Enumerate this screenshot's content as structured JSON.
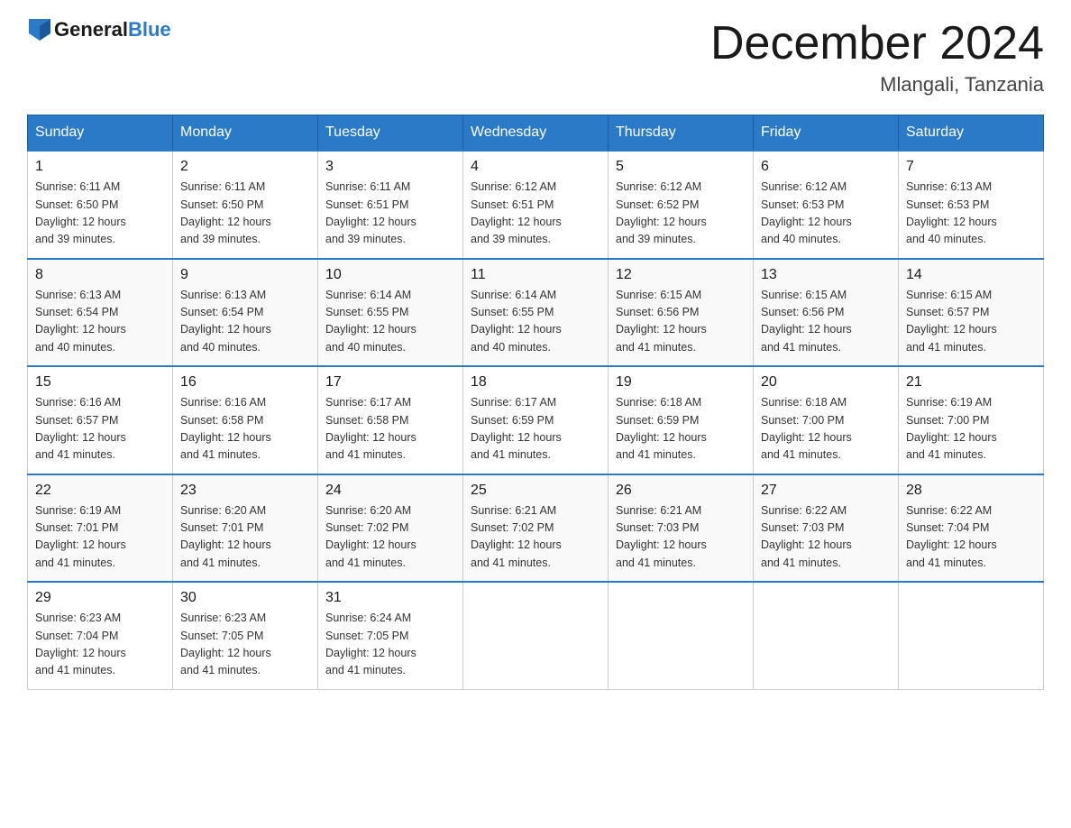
{
  "logo": {
    "general": "General",
    "blue": "Blue"
  },
  "title": "December 2024",
  "location": "Mlangali, Tanzania",
  "days_of_week": [
    "Sunday",
    "Monday",
    "Tuesday",
    "Wednesday",
    "Thursday",
    "Friday",
    "Saturday"
  ],
  "weeks": [
    [
      {
        "day": "1",
        "sunrise": "6:11 AM",
        "sunset": "6:50 PM",
        "daylight": "12 hours and 39 minutes."
      },
      {
        "day": "2",
        "sunrise": "6:11 AM",
        "sunset": "6:50 PM",
        "daylight": "12 hours and 39 minutes."
      },
      {
        "day": "3",
        "sunrise": "6:11 AM",
        "sunset": "6:51 PM",
        "daylight": "12 hours and 39 minutes."
      },
      {
        "day": "4",
        "sunrise": "6:12 AM",
        "sunset": "6:51 PM",
        "daylight": "12 hours and 39 minutes."
      },
      {
        "day": "5",
        "sunrise": "6:12 AM",
        "sunset": "6:52 PM",
        "daylight": "12 hours and 39 minutes."
      },
      {
        "day": "6",
        "sunrise": "6:12 AM",
        "sunset": "6:53 PM",
        "daylight": "12 hours and 40 minutes."
      },
      {
        "day": "7",
        "sunrise": "6:13 AM",
        "sunset": "6:53 PM",
        "daylight": "12 hours and 40 minutes."
      }
    ],
    [
      {
        "day": "8",
        "sunrise": "6:13 AM",
        "sunset": "6:54 PM",
        "daylight": "12 hours and 40 minutes."
      },
      {
        "day": "9",
        "sunrise": "6:13 AM",
        "sunset": "6:54 PM",
        "daylight": "12 hours and 40 minutes."
      },
      {
        "day": "10",
        "sunrise": "6:14 AM",
        "sunset": "6:55 PM",
        "daylight": "12 hours and 40 minutes."
      },
      {
        "day": "11",
        "sunrise": "6:14 AM",
        "sunset": "6:55 PM",
        "daylight": "12 hours and 40 minutes."
      },
      {
        "day": "12",
        "sunrise": "6:15 AM",
        "sunset": "6:56 PM",
        "daylight": "12 hours and 41 minutes."
      },
      {
        "day": "13",
        "sunrise": "6:15 AM",
        "sunset": "6:56 PM",
        "daylight": "12 hours and 41 minutes."
      },
      {
        "day": "14",
        "sunrise": "6:15 AM",
        "sunset": "6:57 PM",
        "daylight": "12 hours and 41 minutes."
      }
    ],
    [
      {
        "day": "15",
        "sunrise": "6:16 AM",
        "sunset": "6:57 PM",
        "daylight": "12 hours and 41 minutes."
      },
      {
        "day": "16",
        "sunrise": "6:16 AM",
        "sunset": "6:58 PM",
        "daylight": "12 hours and 41 minutes."
      },
      {
        "day": "17",
        "sunrise": "6:17 AM",
        "sunset": "6:58 PM",
        "daylight": "12 hours and 41 minutes."
      },
      {
        "day": "18",
        "sunrise": "6:17 AM",
        "sunset": "6:59 PM",
        "daylight": "12 hours and 41 minutes."
      },
      {
        "day": "19",
        "sunrise": "6:18 AM",
        "sunset": "6:59 PM",
        "daylight": "12 hours and 41 minutes."
      },
      {
        "day": "20",
        "sunrise": "6:18 AM",
        "sunset": "7:00 PM",
        "daylight": "12 hours and 41 minutes."
      },
      {
        "day": "21",
        "sunrise": "6:19 AM",
        "sunset": "7:00 PM",
        "daylight": "12 hours and 41 minutes."
      }
    ],
    [
      {
        "day": "22",
        "sunrise": "6:19 AM",
        "sunset": "7:01 PM",
        "daylight": "12 hours and 41 minutes."
      },
      {
        "day": "23",
        "sunrise": "6:20 AM",
        "sunset": "7:01 PM",
        "daylight": "12 hours and 41 minutes."
      },
      {
        "day": "24",
        "sunrise": "6:20 AM",
        "sunset": "7:02 PM",
        "daylight": "12 hours and 41 minutes."
      },
      {
        "day": "25",
        "sunrise": "6:21 AM",
        "sunset": "7:02 PM",
        "daylight": "12 hours and 41 minutes."
      },
      {
        "day": "26",
        "sunrise": "6:21 AM",
        "sunset": "7:03 PM",
        "daylight": "12 hours and 41 minutes."
      },
      {
        "day": "27",
        "sunrise": "6:22 AM",
        "sunset": "7:03 PM",
        "daylight": "12 hours and 41 minutes."
      },
      {
        "day": "28",
        "sunrise": "6:22 AM",
        "sunset": "7:04 PM",
        "daylight": "12 hours and 41 minutes."
      }
    ],
    [
      {
        "day": "29",
        "sunrise": "6:23 AM",
        "sunset": "7:04 PM",
        "daylight": "12 hours and 41 minutes."
      },
      {
        "day": "30",
        "sunrise": "6:23 AM",
        "sunset": "7:05 PM",
        "daylight": "12 hours and 41 minutes."
      },
      {
        "day": "31",
        "sunrise": "6:24 AM",
        "sunset": "7:05 PM",
        "daylight": "12 hours and 41 minutes."
      },
      null,
      null,
      null,
      null
    ]
  ],
  "labels": {
    "sunrise": "Sunrise:",
    "sunset": "Sunset:",
    "daylight": "Daylight:"
  }
}
